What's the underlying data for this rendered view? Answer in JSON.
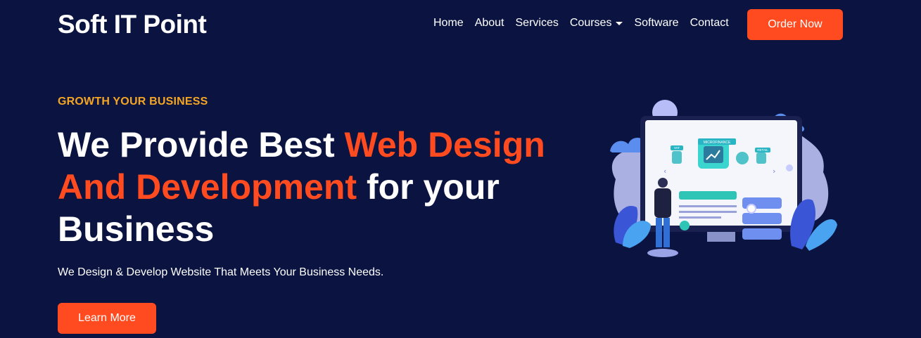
{
  "navbar": {
    "brand": "Soft IT Point",
    "links": [
      {
        "label": "Home"
      },
      {
        "label": "About"
      },
      {
        "label": "Services"
      },
      {
        "label": "Courses"
      },
      {
        "label": "Software"
      },
      {
        "label": "Contact"
      }
    ],
    "order_button": "Order Now"
  },
  "hero": {
    "eyebrow": "GROWTH YOUR BUSINESS",
    "headline_part1": "We Provide Best ",
    "headline_accent": "Web Design And Development",
    "headline_part2": " for your Business",
    "subtext": "We Design & Develop Website That Meets Your Business Needs.",
    "cta": "Learn More"
  },
  "illustration": {
    "labels": [
      "VAT",
      "MICROFINANCE",
      "RETAIL"
    ]
  },
  "colors": {
    "background": "#0b1440",
    "accent": "#ff4b1f",
    "eyebrow": "#f5a524",
    "text": "#ffffff"
  }
}
